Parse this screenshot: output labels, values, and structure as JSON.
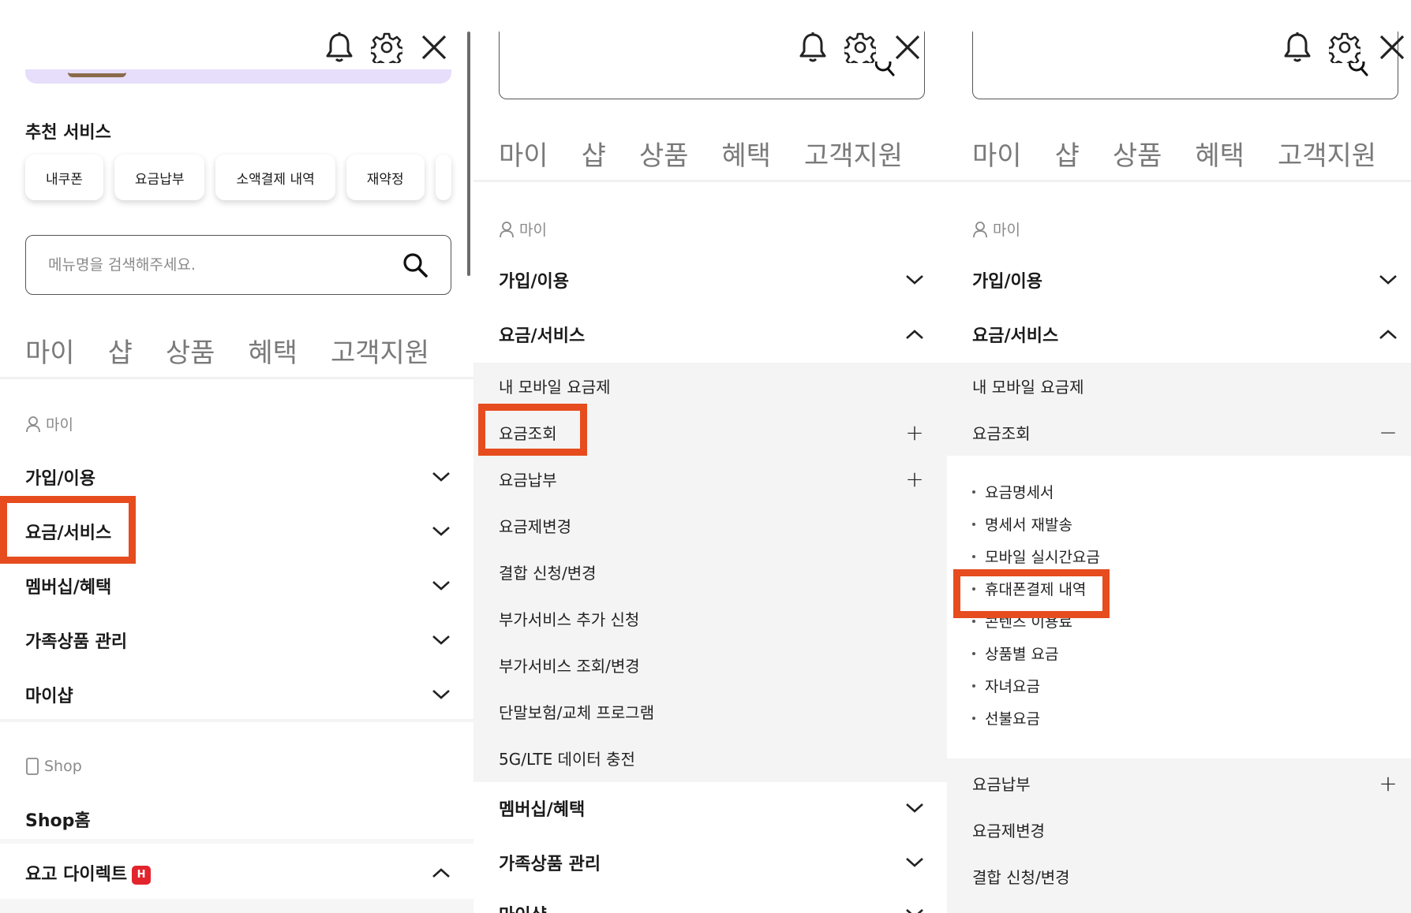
{
  "header": {
    "icons": [
      "bell-icon",
      "gear-icon",
      "close-icon"
    ]
  },
  "panel1": {
    "recommended_title": "추천 서비스",
    "chips": [
      "내쿠폰",
      "요금납부",
      "소액결제 내역",
      "재약정"
    ],
    "search_placeholder": "메뉴명을 검색해주세요.",
    "tabs": [
      "마이",
      "샵",
      "상품",
      "혜택",
      "고객지원"
    ],
    "my_label": "마이",
    "menu": [
      "가입/이용",
      "요금/서비스",
      "멤버십/혜택",
      "가족상품 관리",
      "마이샵"
    ],
    "shop_label": "Shop",
    "shop_home": "Shop홈",
    "direct": "요고 다이렉트",
    "direct_badge": "H"
  },
  "panel2": {
    "tabs": [
      "마이",
      "샵",
      "상품",
      "혜택",
      "고객지원"
    ],
    "my_label": "마이",
    "menu_top": [
      "가입/이용",
      "요금/서비스"
    ],
    "sub_items": [
      "내 모바일 요금제",
      "요금조회",
      "요금납부",
      "요금제변경",
      "결합 신청/변경",
      "부가서비스 추가 신청",
      "부가서비스 조회/변경",
      "단말보험/교체 프로그램",
      "5G/LTE 데이터 충전"
    ],
    "menu_bottom": [
      "멤버십/혜택",
      "가족상품 관리",
      "마이샵"
    ]
  },
  "panel3": {
    "tabs": [
      "마이",
      "샵",
      "상품",
      "혜택",
      "고객지원"
    ],
    "my_label": "마이",
    "menu_top": [
      "가입/이용",
      "요금/서비스"
    ],
    "sub_items_top": [
      "내 모바일 요금제",
      "요금조회"
    ],
    "leaves": [
      "요금명세서",
      "명세서 재발송",
      "모바일 실시간요금",
      "휴대폰결제 내역",
      "콘텐츠 이용료",
      "상품별 요금",
      "자녀요금",
      "선불요금"
    ],
    "sub_items_bottom": [
      "요금납부",
      "요금제변경",
      "결합 신청/변경"
    ]
  },
  "colors": {
    "highlight": "#e64c1e",
    "badge": "#e2242d",
    "banner": "#e6defa"
  }
}
